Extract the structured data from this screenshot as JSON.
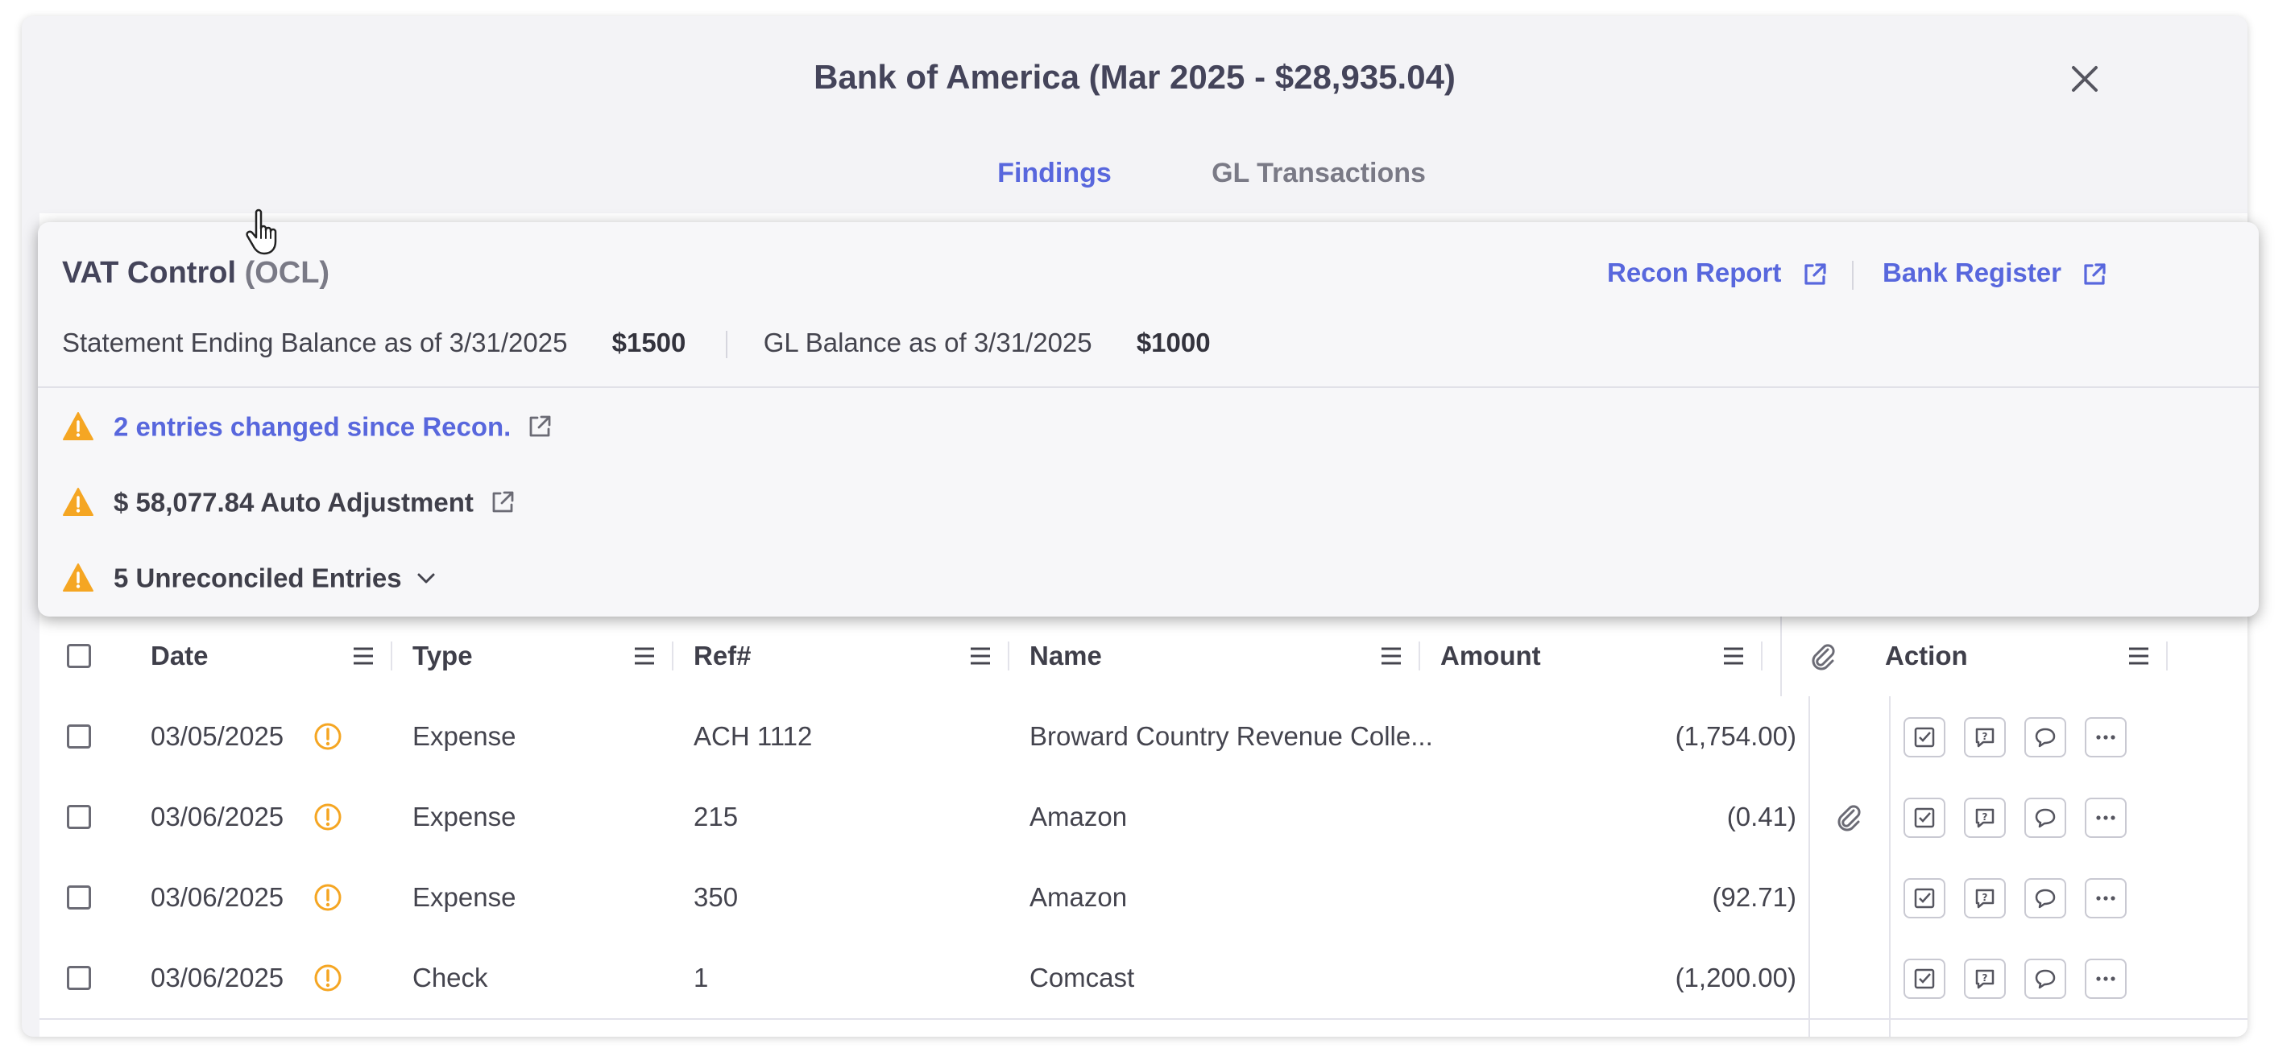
{
  "modal": {
    "title": "Bank of America (Mar 2025 - $28,935.04)",
    "tabs": [
      {
        "label": "Findings",
        "active": true
      },
      {
        "label": "GL Transactions",
        "active": false
      }
    ]
  },
  "findings": {
    "title": "VAT Control",
    "subtitle": "(OCL)",
    "links": {
      "recon_report": "Recon Report",
      "bank_register": "Bank Register"
    },
    "statement_label": "Statement Ending Balance as of 3/31/2025",
    "statement_value": "$1500",
    "gl_label": "GL Balance as of 3/31/2025",
    "gl_value": "$1000",
    "items": [
      {
        "text": "2 entries changed since Recon.",
        "type": "link",
        "icon": "warning-triangle-icon"
      },
      {
        "text": "$ 58,077.84 Auto Adjustment",
        "type": "text",
        "icon": "warning-triangle-icon"
      },
      {
        "text": "5 Unreconciled Entries",
        "type": "expandable",
        "icon": "warning-triangle-icon"
      }
    ]
  },
  "table": {
    "columns": {
      "date": "Date",
      "type": "Type",
      "ref": "Ref#",
      "name": "Name",
      "amount": "Amount",
      "action": "Action"
    },
    "rows": [
      {
        "date": "03/05/2025",
        "type": "Expense",
        "ref": "ACH 1112",
        "name": "Broward Country Revenue Colle...",
        "amount": "(1,754.00)",
        "attachment": false
      },
      {
        "date": "03/06/2025",
        "type": "Expense",
        "ref": "215",
        "name": "Amazon",
        "amount": "(0.41)",
        "attachment": true
      },
      {
        "date": "03/06/2025",
        "type": "Expense",
        "ref": "350",
        "name": "Amazon",
        "amount": "(92.71)",
        "attachment": false
      },
      {
        "date": "03/06/2025",
        "type": "Check",
        "ref": "1",
        "name": "Comcast",
        "amount": "(1,200.00)",
        "attachment": false
      }
    ]
  },
  "colors": {
    "accent": "#5867dd",
    "warning": "#f5a623",
    "text": "#3f3f4a",
    "muted": "#7a7a86"
  }
}
